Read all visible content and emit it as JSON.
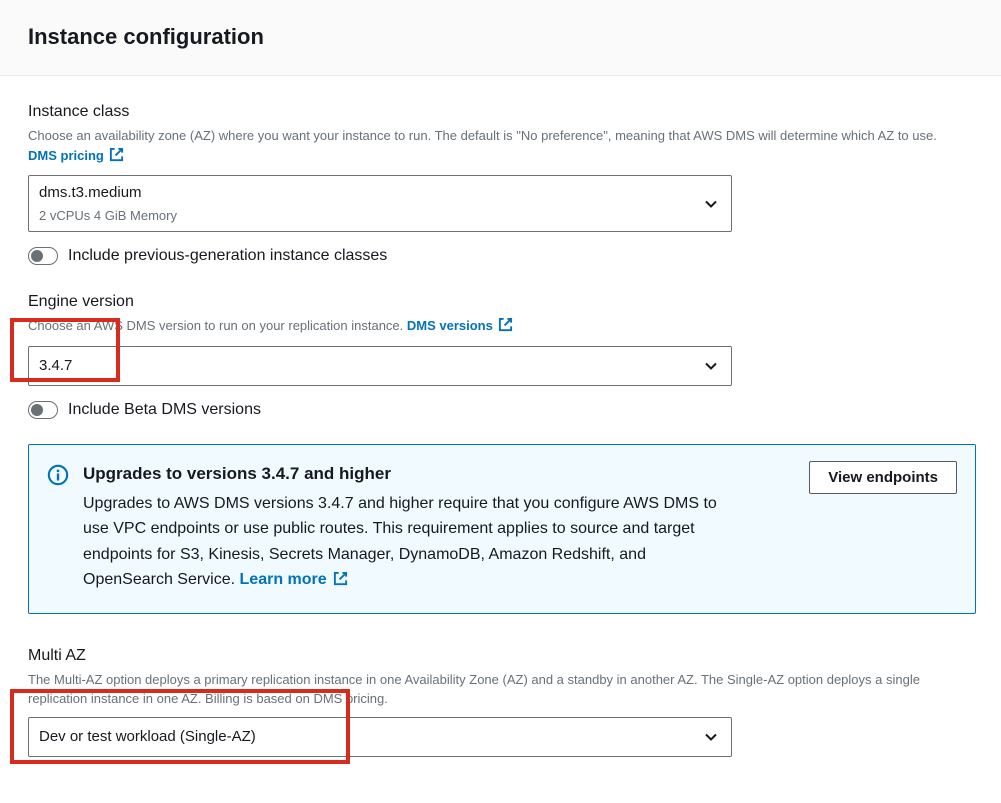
{
  "header": {
    "title": "Instance configuration"
  },
  "instance_class": {
    "label": "Instance class",
    "description_a": "Choose an availability zone (AZ) where you want your instance to run. The default is \"No preference\", meaning that AWS DMS will determine which AZ to use. ",
    "link_text": "DMS pricing",
    "selected_primary": "dms.t3.medium",
    "selected_secondary": "2 vCPUs    4 GiB Memory",
    "toggle_label": "Include previous-generation instance classes"
  },
  "engine_version": {
    "label": "Engine version",
    "description_a": "Choose an AWS DMS version to run on your replication instance. ",
    "link_text": "DMS versions",
    "selected": "3.4.7",
    "toggle_label": "Include Beta DMS versions"
  },
  "alert": {
    "title": "Upgrades to versions 3.4.7 and higher",
    "body": "Upgrades to AWS DMS versions 3.4.7 and higher require that you configure AWS DMS to use VPC endpoints or use public routes. This requirement applies to source and target endpoints for S3, Kinesis, Secrets Manager, DynamoDB, Amazon Redshift, and OpenSearch Service. ",
    "learn_more": "Learn more",
    "button": "View endpoints"
  },
  "multi_az": {
    "label": "Multi AZ",
    "description": "The Multi-AZ option deploys a primary replication instance in one Availability Zone (AZ) and a standby in another AZ. The Single-AZ option deploys a single replication instance in one AZ. Billing is based on DMS pricing.",
    "selected": "Dev or test workload (Single-AZ)"
  }
}
